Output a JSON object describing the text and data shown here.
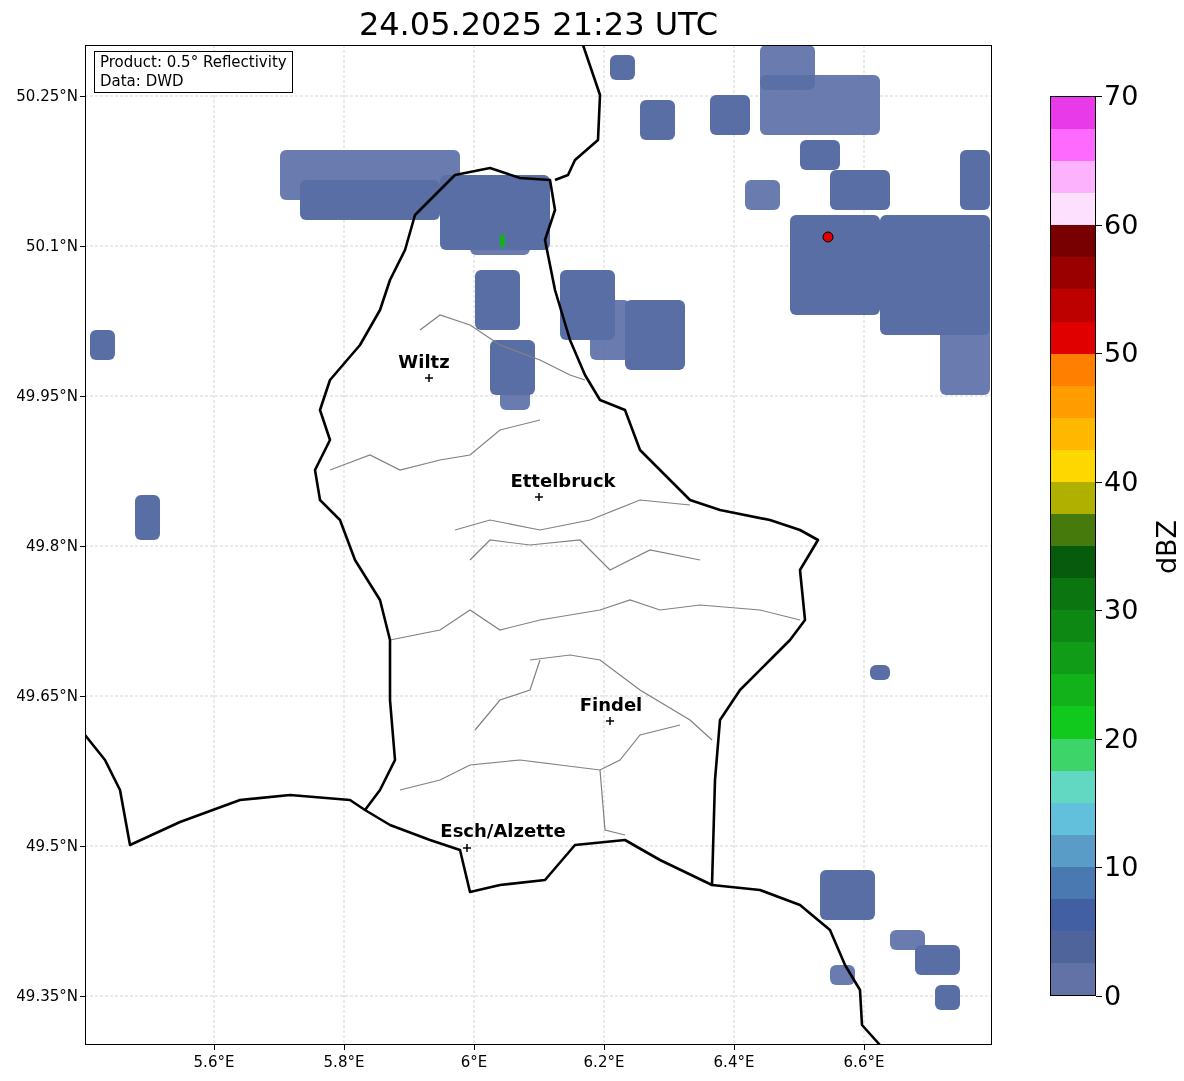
{
  "title": "24.05.2025 21:23 UTC",
  "legend": [
    "Product: 0.5° Reflectivity",
    "Data: DWD"
  ],
  "map": {
    "lat_ticks": [
      "50.25°N",
      "50.1°N",
      "49.95°N",
      "49.8°N",
      "49.65°N",
      "49.5°N",
      "49.35°N"
    ],
    "lon_ticks": [
      "5.6°E",
      "5.8°E",
      "6°E",
      "6.2°E",
      "6.4°E",
      "6.6°E"
    ],
    "cities": [
      {
        "name": "Wiltz"
      },
      {
        "name": "Ettelbruck"
      },
      {
        "name": "Findel"
      },
      {
        "name": "Esch/Alzette"
      }
    ]
  },
  "colorbar": {
    "label": "dBZ",
    "ticks": [
      "70",
      "60",
      "50",
      "40",
      "30",
      "20",
      "10",
      "0"
    ],
    "segments": [
      {
        "color": "#e83ae8"
      },
      {
        "color": "#fd6afd"
      },
      {
        "color": "#fcb2fc"
      },
      {
        "color": "#fde0fd"
      },
      {
        "color": "#780000"
      },
      {
        "color": "#9a0000"
      },
      {
        "color": "#bd0000"
      },
      {
        "color": "#e00000"
      },
      {
        "color": "#ff7f00"
      },
      {
        "color": "#ff9d00"
      },
      {
        "color": "#ffb700"
      },
      {
        "color": "#ffd700"
      },
      {
        "color": "#b0b000"
      },
      {
        "color": "#477a0c"
      },
      {
        "color": "#065c0c"
      },
      {
        "color": "#0b7510"
      },
      {
        "color": "#0d8813"
      },
      {
        "color": "#109c16"
      },
      {
        "color": "#12b21a"
      },
      {
        "color": "#10c91c"
      },
      {
        "color": "#3dd46a"
      },
      {
        "color": "#62d7c2"
      },
      {
        "color": "#62c0dd"
      },
      {
        "color": "#5a9cc8"
      },
      {
        "color": "#4a78b0"
      },
      {
        "color": "#425fa4"
      },
      {
        "color": "#50649c"
      },
      {
        "color": "#6272a6"
      }
    ]
  }
}
